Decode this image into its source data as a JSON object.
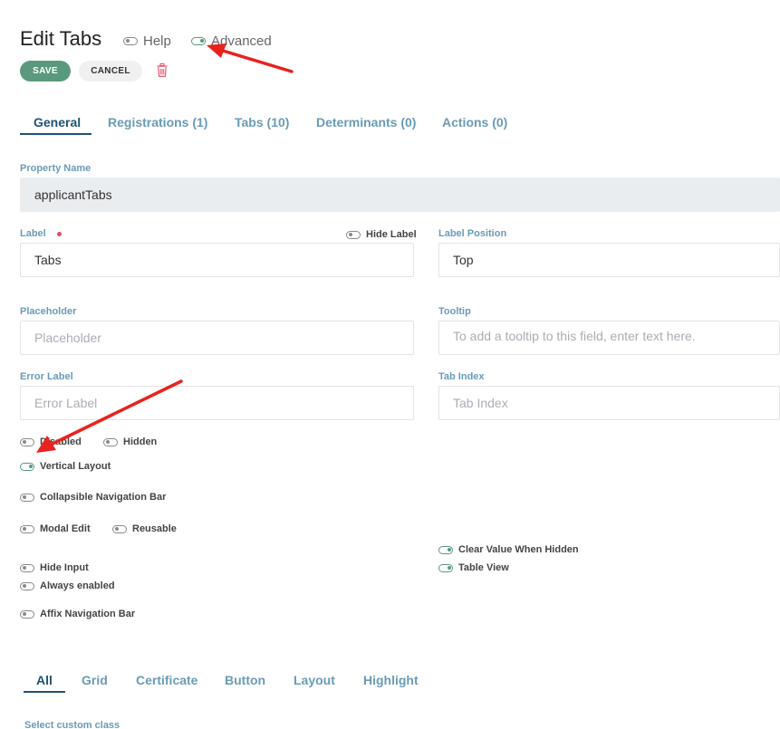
{
  "header": {
    "title": "Edit Tabs",
    "help_label": "Help",
    "advanced_label": "Advanced"
  },
  "toolbar": {
    "save_label": "SAVE",
    "cancel_label": "CANCEL",
    "delete_icon": "trash-icon"
  },
  "tabs": [
    {
      "label": "General",
      "active": true
    },
    {
      "label": "Registrations (1)",
      "active": false
    },
    {
      "label": "Tabs (10)",
      "active": false
    },
    {
      "label": "Determinants (0)",
      "active": false
    },
    {
      "label": "Actions (0)",
      "active": false
    }
  ],
  "fields": {
    "property_name": {
      "label": "Property Name",
      "value": "applicantTabs"
    },
    "label": {
      "label": "Label",
      "value": "Tabs",
      "hide_label": "Hide Label"
    },
    "label_position": {
      "label": "Label Position",
      "value": "Top"
    },
    "placeholder": {
      "label": "Placeholder",
      "placeholder": "Placeholder"
    },
    "tooltip": {
      "label": "Tooltip",
      "placeholder": "To add a tooltip to this field, enter text here."
    },
    "error_label": {
      "label": "Error Label",
      "placeholder": "Error Label"
    },
    "tab_index": {
      "label": "Tab Index",
      "placeholder": "Tab Index"
    }
  },
  "options": {
    "disabled": {
      "label": "Disabled",
      "on": false
    },
    "hidden": {
      "label": "Hidden",
      "on": false
    },
    "vertical_layout": {
      "label": "Vertical Layout",
      "on": true
    },
    "collapsible_nav": {
      "label": "Collapsible Navigation Bar",
      "on": false
    },
    "modal_edit": {
      "label": "Modal Edit",
      "on": false
    },
    "reusable": {
      "label": "Reusable",
      "on": false
    },
    "clear_value_when_hidden": {
      "label": "Clear Value When Hidden",
      "on": true
    },
    "table_view": {
      "label": "Table View",
      "on": true
    },
    "hide_input": {
      "label": "Hide Input",
      "on": false
    },
    "always_enabled": {
      "label": "Always enabled",
      "on": false
    },
    "affix_nav": {
      "label": "Affix Navigation Bar",
      "on": false
    }
  },
  "sub_tabs": [
    {
      "label": "All",
      "active": true
    },
    {
      "label": "Grid",
      "active": false
    },
    {
      "label": "Certificate",
      "active": false
    },
    {
      "label": "Button",
      "active": false
    },
    {
      "label": "Layout",
      "active": false
    },
    {
      "label": "Highlight",
      "active": false
    }
  ],
  "bottom": {
    "select_custom_class": "Select custom class"
  },
  "colors": {
    "accent": "#5a9a7c",
    "tab_active": "#1f5375",
    "tab_inactive": "#6a9bb6",
    "annotation": "#e8231f"
  }
}
